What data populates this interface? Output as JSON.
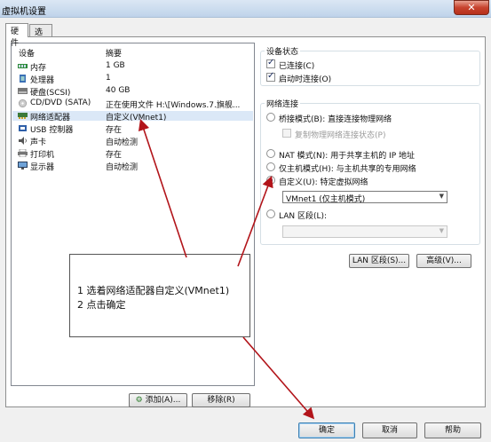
{
  "window": {
    "title": "虚拟机设置",
    "close_label": "✕"
  },
  "tabs": [
    {
      "label": "硬件"
    },
    {
      "label": "选项"
    }
  ],
  "device_list": {
    "headers": {
      "device": "设备",
      "summary": "摘要"
    },
    "rows": [
      {
        "name": "内存",
        "summary": "1 GB",
        "icon": "memory-icon"
      },
      {
        "name": "处理器",
        "summary": "1",
        "icon": "processor-icon"
      },
      {
        "name": "硬盘(SCSI)",
        "summary": "40 GB",
        "icon": "hard-disk-icon"
      },
      {
        "name": "CD/DVD (SATA)",
        "summary": "正在使用文件 H:\\[Windows.7.旗舰...",
        "icon": "cd-dvd-icon"
      },
      {
        "name": "网络适配器",
        "summary": "自定义(VMnet1)",
        "icon": "network-adapter-icon"
      },
      {
        "name": "USB 控制器",
        "summary": "存在",
        "icon": "usb-controller-icon"
      },
      {
        "name": "声卡",
        "summary": "自动检测",
        "icon": "sound-card-icon"
      },
      {
        "name": "打印机",
        "summary": "存在",
        "icon": "printer-icon"
      },
      {
        "name": "显示器",
        "summary": "自动检测",
        "icon": "display-icon"
      }
    ],
    "add_button": "添加(A)...",
    "remove_button": "移除(R)"
  },
  "device_status": {
    "legend": "设备状态",
    "connected": "已连接(C)",
    "connect_at_power_on": "启动时连接(O)"
  },
  "network_connection": {
    "legend": "网络连接",
    "bridged": "桥接模式(B): 直接连接物理网络",
    "replicate_state": "复制物理网络连接状态(P)",
    "nat": "NAT 模式(N): 用于共享主机的 IP 地址",
    "host_only": "仅主机模式(H): 与主机共享的专用网络",
    "custom": "自定义(U): 特定虚拟网络",
    "custom_selected": "VMnet1 (仅主机模式)",
    "lan_segment": "LAN 区段(L):",
    "lan_segment_value": ""
  },
  "buttons": {
    "lan_segments": "LAN 区段(S)...",
    "advanced": "高级(V)..."
  },
  "callout": {
    "line1": "1  选着网络适配器自定义(VMnet1)",
    "line2": "2  点击确定"
  },
  "footer": {
    "ok": "确定",
    "cancel": "取消",
    "help": "帮助"
  },
  "colors": {
    "arrow": "#b2141a",
    "selection": "#dbe8f7"
  }
}
